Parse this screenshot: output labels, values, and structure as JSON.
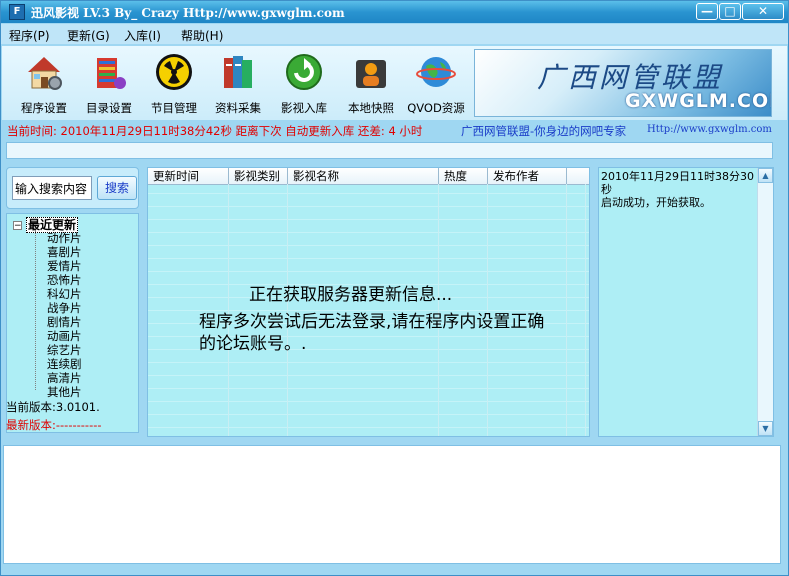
{
  "window": {
    "title": "迅风影视 LV.3 By_ Crazy Http://www.gxwglm.com",
    "icon": "app-logo-icon",
    "controls": [
      "minimize",
      "maximize",
      "close"
    ]
  },
  "menu": {
    "items": [
      {
        "label": "程序(P)"
      },
      {
        "label": "更新(G)"
      },
      {
        "label": "入库(I)"
      },
      {
        "label": "帮助(H)"
      }
    ]
  },
  "toolbar": {
    "items": [
      {
        "label": "程序设置",
        "icon": "house-settings-icon"
      },
      {
        "label": "目录设置",
        "icon": "folder-settings-icon"
      },
      {
        "label": "节目管理",
        "icon": "radiation-icon"
      },
      {
        "label": "资料采集",
        "icon": "books-icon"
      },
      {
        "label": "影视入库",
        "icon": "green-arrow-icon"
      },
      {
        "label": "本地快照",
        "icon": "person-camera-icon"
      },
      {
        "label": "QVOD资源",
        "icon": "globe-icon"
      }
    ],
    "banner": {
      "script_text": "广西网管联盟",
      "logo_text": "GXWGLM.COM"
    }
  },
  "status": {
    "time_text": "当前时间: 2010年11月29日11时38分42秒  距离下次 自动更新入库 还差: 4 小时",
    "slogan": "广西网管联盟-你身边的网吧专家",
    "url": "Http://www.gxwglm.com"
  },
  "search": {
    "placeholder": "输入搜索内容",
    "button_label": "搜索"
  },
  "tree": {
    "root_label": "最近更新",
    "children": [
      "动作片",
      "喜剧片",
      "爱情片",
      "恐怖片",
      "科幻片",
      "战争片",
      "剧情片",
      "动画片",
      "综艺片",
      "连续剧",
      "高清片",
      "其他片"
    ]
  },
  "version": {
    "current": "当前版本:3.0101.",
    "latest": "最新版本:-----------"
  },
  "list": {
    "columns": [
      "更新时间",
      "影视类别",
      "影视名称",
      "热度",
      "发布作者"
    ],
    "message_line1": "正在获取服务器更新信息...",
    "message_line2": "程序多次尝试后无法登录,请在程序内设置正确的论坛账号。."
  },
  "log": {
    "lines": [
      "2010年11月29日11时38分30秒",
      "启动成功，开始获取。"
    ]
  },
  "colors": {
    "title_bar": "#2a94d1",
    "panel_bg": "#aeeef5",
    "window_bg": "#9fd7f2",
    "status_red": "#e00000",
    "link_blue": "#1a3cc8"
  }
}
